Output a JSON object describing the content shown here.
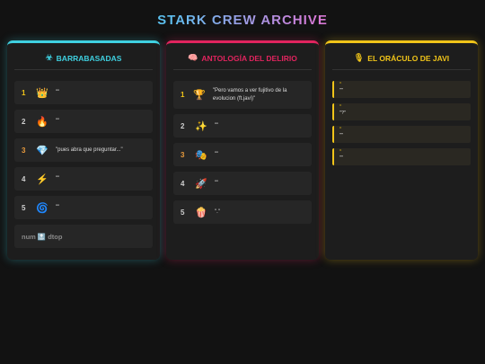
{
  "header": {
    "title": "STARK CREW ARCHIVE"
  },
  "panels": {
    "barrabasadas": {
      "title": "BARRABASADAS",
      "icon": "☣",
      "items": [
        {
          "rank": "1",
          "emoji": "👑",
          "text": "\"\""
        },
        {
          "rank": "2",
          "emoji": "🔥",
          "text": "\"\""
        },
        {
          "rank": "3",
          "emoji": "💎",
          "text": "\"pues abra que preguntar...\""
        },
        {
          "rank": "4",
          "emoji": "⚡",
          "text": "\"\""
        },
        {
          "rank": "5",
          "emoji": "🌀",
          "text": "\"\""
        }
      ],
      "footer": {
        "left": "num",
        "icon": "🔝",
        "right": "dtop"
      }
    },
    "antologia": {
      "title": "ANTOLOGÍA DEL DELIRIO",
      "icon": "🧠",
      "items": [
        {
          "rank": "1",
          "emoji": "🏆",
          "text": "\"Pero vamos a ver fujitivo de la evolucion (ft.javi)\""
        },
        {
          "rank": "2",
          "emoji": "✨",
          "text": "\"\""
        },
        {
          "rank": "3",
          "emoji": "🎭",
          "text": "\"\""
        },
        {
          "rank": "4",
          "emoji": "🚀",
          "text": "\"\""
        },
        {
          "rank": "5",
          "emoji": "🍿",
          "text": "\".\""
        }
      ]
    },
    "oraculo": {
      "title": "EL ORÁCULO DE JAVI",
      "icon": "🎙",
      "quotes": [
        {
          "mark": "“",
          "text": "\"\""
        },
        {
          "mark": "“",
          "text": "\"?\""
        },
        {
          "mark": "“",
          "text": "\"\""
        },
        {
          "mark": "“",
          "text": "\"\""
        }
      ]
    }
  },
  "colors": {
    "cyan": "#3fd0e0",
    "magenta": "#e0245e",
    "gold": "#f0c419",
    "background": "#121212"
  }
}
